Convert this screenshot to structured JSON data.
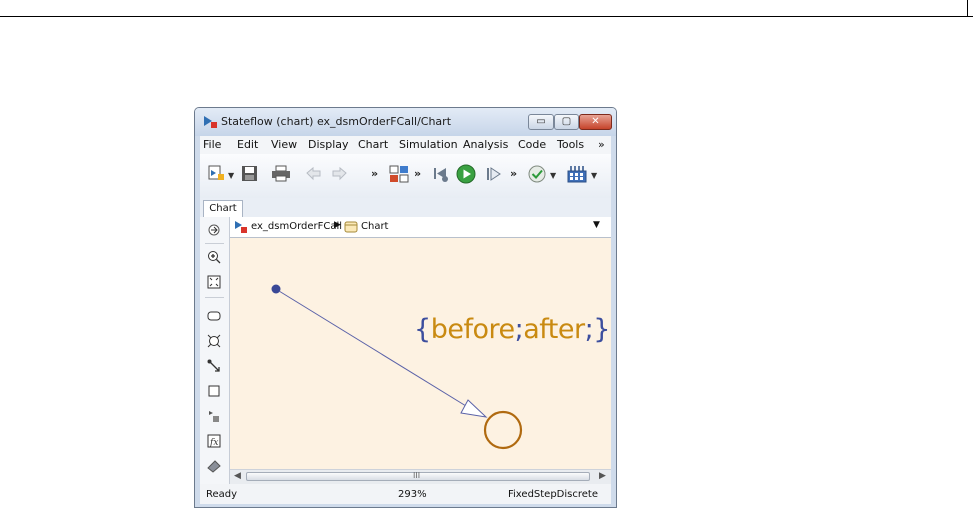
{
  "window": {
    "title": "Stateflow (chart) ex_dsmOrderFCall/Chart",
    "controls": {
      "minimize": "▭",
      "maximize": "▢",
      "close": "✕"
    }
  },
  "menu": [
    "File",
    "Edit",
    "View",
    "Display",
    "Chart",
    "Simulation",
    "Analysis",
    "Code",
    "Tools",
    "»"
  ],
  "toolbar": {
    "more": "»"
  },
  "tabs": [
    "Chart"
  ],
  "breadcrumb": {
    "model": "ex_dsmOrderFCall",
    "chart": "Chart"
  },
  "canvas": {
    "open_brace": "{",
    "action1": "before",
    "sep1": ";",
    "action2": "after",
    "sep2": ";",
    "close_brace": "}",
    "colors": {
      "background": "#fdf2e2",
      "transition": "#5a62a8",
      "junction": "#b06a10",
      "braces": "#3c4e9e",
      "actions": "#c98a11"
    }
  },
  "scrollbar": {
    "grip": "III"
  },
  "status": {
    "left": "Ready",
    "zoom": "293%",
    "solver": "FixedStepDiscrete"
  }
}
